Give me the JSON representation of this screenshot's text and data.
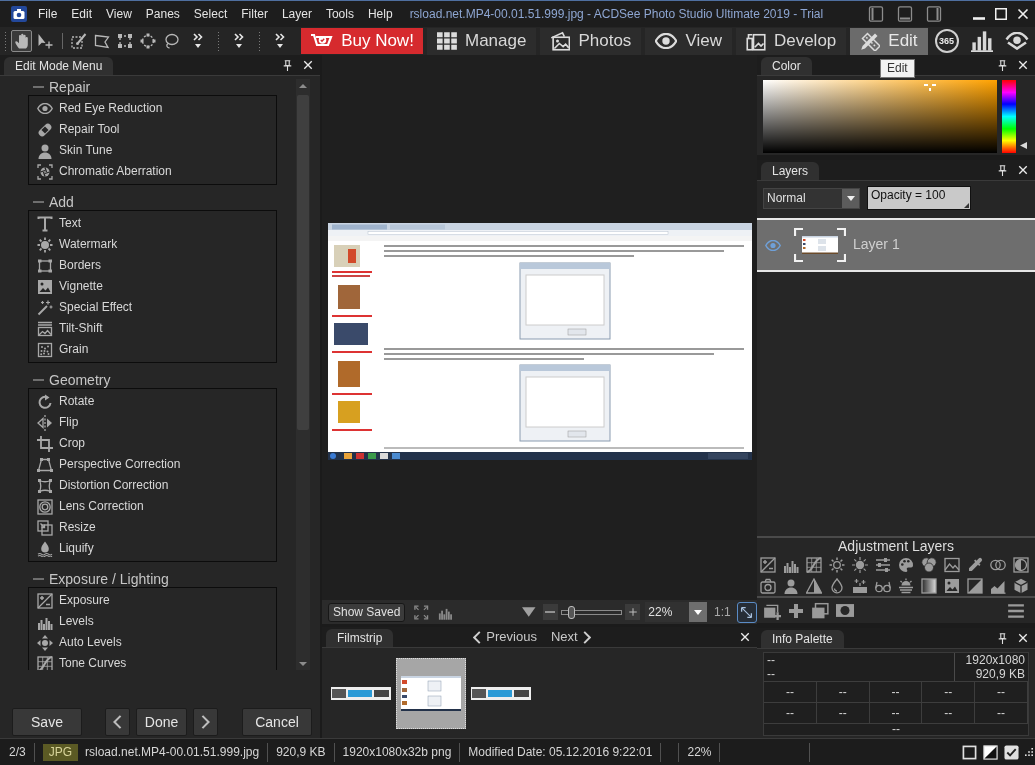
{
  "window": {
    "title": "rsload.net.MP4-00.01.51.999.jpg - ACDSee Photo Studio Ultimate 2019 - Trial"
  },
  "menu": [
    "File",
    "Edit",
    "View",
    "Panes",
    "Select",
    "Filter",
    "Layer",
    "Tools",
    "Help"
  ],
  "tools": [
    {
      "selected": true
    },
    {
      "selected": false
    },
    {
      "selected": false
    },
    {
      "selected": false
    },
    {
      "selected": false
    },
    {
      "selected": false
    },
    {
      "selected": false
    }
  ],
  "buy_button": "Buy Now!",
  "modes": [
    {
      "label": "Manage",
      "selected": false
    },
    {
      "label": "Photos",
      "selected": false
    },
    {
      "label": "View",
      "selected": false
    },
    {
      "label": "Develop",
      "selected": false
    },
    {
      "label": "Edit",
      "selected": true
    }
  ],
  "online_button": "365",
  "tooltip": "Edit",
  "edit_menu": {
    "title": "Edit Mode Menu",
    "groups": [
      {
        "title": "Repair",
        "expanded": true,
        "items": [
          "Red Eye Reduction",
          "Repair Tool",
          "Skin Tune",
          "Chromatic Aberration"
        ]
      },
      {
        "title": "Add",
        "expanded": true,
        "items": [
          "Text",
          "Watermark",
          "Borders",
          "Vignette",
          "Special Effect",
          "Tilt-Shift",
          "Grain"
        ]
      },
      {
        "title": "Geometry",
        "expanded": true,
        "items": [
          "Rotate",
          "Flip",
          "Crop",
          "Perspective Correction",
          "Distortion Correction",
          "Lens Correction",
          "Resize",
          "Liquify"
        ]
      },
      {
        "title": "Exposure / Lighting",
        "expanded": true,
        "items": [
          "Exposure",
          "Levels",
          "Auto Levels",
          "Tone Curves"
        ]
      }
    ],
    "buttons": {
      "save": "Save",
      "done": "Done",
      "cancel": "Cancel"
    }
  },
  "view_toolbar": {
    "show_saved": "Show Saved",
    "zoom_slider": {
      "level": 0.12
    },
    "zoom": "22%",
    "actual_size": "1:1"
  },
  "filmstrip": {
    "title": "Filmstrip",
    "previous": "Previous",
    "next": "Next",
    "thumbnails": [
      {
        "selected": false
      },
      {
        "selected": true
      },
      {
        "selected": false
      }
    ]
  },
  "color_panel": {
    "title": "Color"
  },
  "layers": {
    "title": "Layers",
    "blend_mode": "Normal",
    "opacity": "Opacity = 100",
    "items": [
      {
        "name": "Layer 1",
        "visible": true,
        "selected": true
      }
    ],
    "adjustment_title": "Adjustment Layers"
  },
  "info_palette": {
    "title": "Info Palette",
    "summary": [
      {
        "left": "--",
        "right": "1920x1080"
      },
      {
        "left": "--",
        "right": "920,9 KB"
      }
    ],
    "grid": [
      [
        "--",
        "--",
        "--",
        "--",
        "--"
      ],
      [
        "--",
        "--",
        "--",
        "--",
        "--"
      ]
    ],
    "footer": "--"
  },
  "status_bar": {
    "position": "2/3",
    "format": "JPG",
    "file": "rsload.net.MP4-00.01.51.999.jpg",
    "size": "920,9 KB",
    "dimensions": "1920x1080x32b png",
    "modified": "Modified Date: 05.12.2016 9:22:01",
    "zoom": "22%"
  }
}
